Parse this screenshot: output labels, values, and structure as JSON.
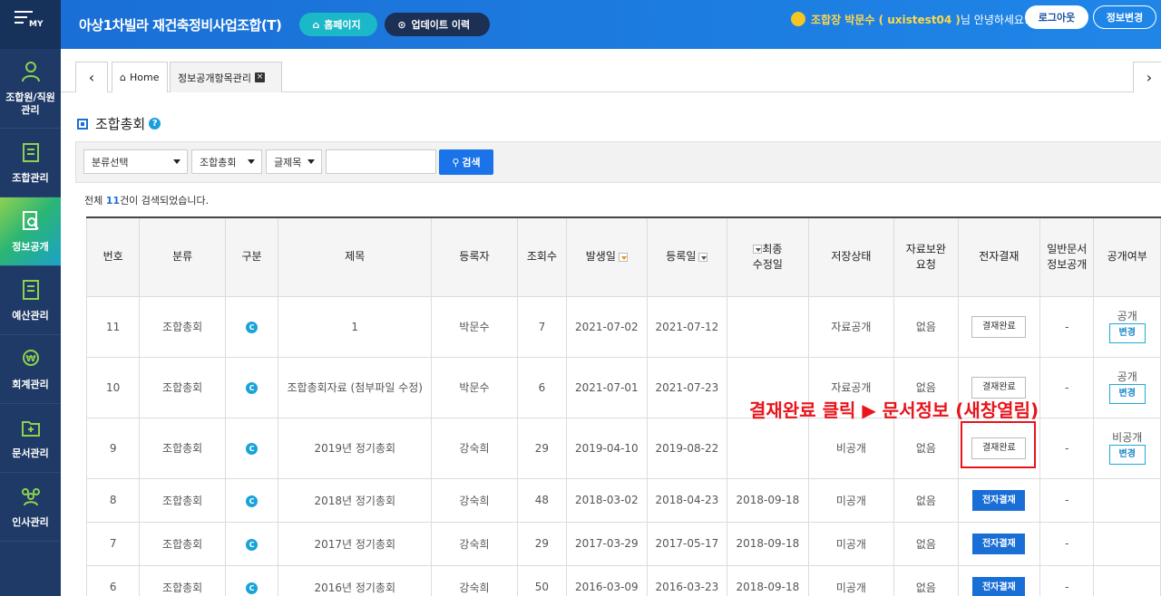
{
  "app_title": "아상1차빌라 재건축정비사업조합(T)",
  "header": {
    "home_btn": "홈페이지",
    "update_btn": "업데이트 이력",
    "user_role": "조합장 박문수 ( uxistest04 )",
    "user_suffix": "님 안녕하세요!",
    "logout_btn": "로그아웃",
    "profile_btn": "정보변경"
  },
  "sidebar": {
    "logo": "MY",
    "items": [
      {
        "label": "조합원/직원\n관리",
        "icon": "person-icon"
      },
      {
        "label": "조합관리",
        "icon": "building-icon"
      },
      {
        "label": "정보공개",
        "icon": "document-search-icon"
      },
      {
        "label": "예산관리",
        "icon": "calculator-icon"
      },
      {
        "label": "회계관리",
        "icon": "coin-icon"
      },
      {
        "label": "문서관리",
        "icon": "folder-icon"
      },
      {
        "label": "인사관리",
        "icon": "people-icon"
      }
    ]
  },
  "tabs": {
    "home": "Home",
    "current": "정보공개항목관리"
  },
  "page": {
    "title": "조합총회"
  },
  "search": {
    "category_select": "분류선택",
    "type_select": "조합총회",
    "field_select": "글제목",
    "input_value": "",
    "button": "검색"
  },
  "result": {
    "prefix": "전체 ",
    "count": "11",
    "suffix": "건이 검색되었습니다."
  },
  "table": {
    "headers": [
      "번호",
      "분류",
      "구분",
      "제목",
      "등록자",
      "조회수",
      "발생일",
      "등록일",
      "최종\n수정일",
      "저장상태",
      "자료보완\n요청",
      "전자결재",
      "일반문서\n정보공개",
      "공개여부"
    ],
    "rows": [
      {
        "no": "11",
        "cat": "조합총회",
        "type": "C",
        "title": "1",
        "author": "박문수",
        "views": "7",
        "occurred": "2021-07-02",
        "registered": "2021-07-12",
        "modified": "",
        "status": "자료공개",
        "supplement": "없음",
        "esign": "결재완료",
        "esign_style": "done",
        "general": "-",
        "public": "공개",
        "change": "변경"
      },
      {
        "no": "10",
        "cat": "조합총회",
        "type": "C",
        "title": "조합총회자료 (첨부파일 수정)",
        "author": "박문수",
        "views": "6",
        "occurred": "2021-07-01",
        "registered": "2021-07-23",
        "modified": "",
        "status": "자료공개",
        "supplement": "없음",
        "esign": "결재완료",
        "esign_style": "done",
        "general": "-",
        "public": "공개",
        "change": "변경"
      },
      {
        "no": "9",
        "cat": "조합총회",
        "type": "C",
        "title": "2019년 정기총회",
        "author": "강숙희",
        "views": "29",
        "occurred": "2019-04-10",
        "registered": "2019-08-22",
        "modified": "",
        "status": "비공개",
        "supplement": "없음",
        "esign": "결재완료",
        "esign_style": "done",
        "general": "-",
        "public": "비공개",
        "change": "변경"
      },
      {
        "no": "8",
        "cat": "조합총회",
        "type": "C",
        "title": "2018년 정기총회",
        "author": "강숙희",
        "views": "48",
        "occurred": "2018-03-02",
        "registered": "2018-04-23",
        "modified": "2018-09-18",
        "status": "미공개",
        "supplement": "없음",
        "esign": "전자결재",
        "esign_style": "esign",
        "general": "-",
        "public": "",
        "change": ""
      },
      {
        "no": "7",
        "cat": "조합총회",
        "type": "C",
        "title": "2017년 정기총회",
        "author": "강숙희",
        "views": "29",
        "occurred": "2017-03-29",
        "registered": "2017-05-17",
        "modified": "2018-09-18",
        "status": "미공개",
        "supplement": "없음",
        "esign": "전자결재",
        "esign_style": "esign",
        "general": "-",
        "public": "",
        "change": ""
      },
      {
        "no": "6",
        "cat": "조합총회",
        "type": "C",
        "title": "2016년 정기총회",
        "author": "강숙희",
        "views": "50",
        "occurred": "2016-03-09",
        "registered": "2016-03-23",
        "modified": "2018-09-18",
        "status": "미공개",
        "supplement": "없음",
        "esign": "전자결재",
        "esign_style": "esign",
        "general": "-",
        "public": "",
        "change": ""
      }
    ]
  },
  "annotation": "결재완료 클릭 ▶ 문서정보 (새창열림)",
  "colors": {
    "primary": "#1a6fd6",
    "sidebar": "#1f3a66",
    "annotation": "#e8141b"
  }
}
